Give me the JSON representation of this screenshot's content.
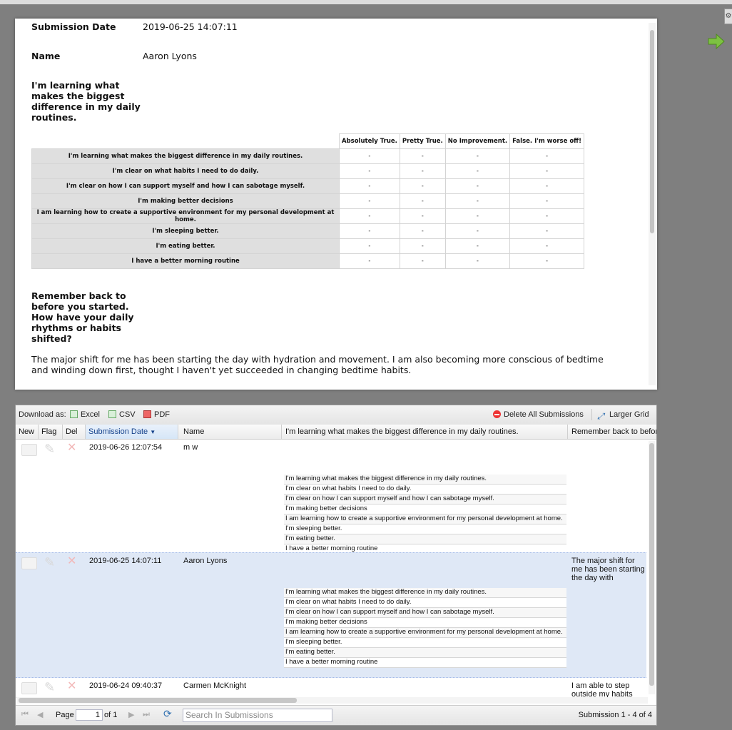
{
  "detail": {
    "submission_date_label": "Submission Date",
    "submission_date_value": "2019-06-25 14:07:11",
    "name_label": "Name",
    "name_value": "Aaron Lyons",
    "matrix_question": "I'm learning what makes the biggest difference in my daily routines.",
    "matrix_columns": [
      "Absolutely True.",
      "Pretty True.",
      "No Improvement.",
      "False. I'm worse off!"
    ],
    "matrix_rows": [
      {
        "label": "I'm learning what makes the biggest difference in my daily routines.",
        "values": [
          "-",
          "-",
          "-",
          "-"
        ]
      },
      {
        "label": "I'm clear on what habits I need to do daily.",
        "values": [
          "-",
          "-",
          "-",
          "-"
        ]
      },
      {
        "label": "I'm clear on how I can support myself and how I can sabotage myself.",
        "values": [
          "-",
          "-",
          "-",
          "-"
        ]
      },
      {
        "label": "I'm making better decisions",
        "values": [
          "-",
          "-",
          "-",
          "-"
        ]
      },
      {
        "label": "I am learning how to create a supportive environment for my personal development at home.",
        "values": [
          "-",
          "-",
          "-",
          "-"
        ]
      },
      {
        "label": "I'm sleeping better.",
        "values": [
          "-",
          "-",
          "-",
          "-"
        ]
      },
      {
        "label": "I'm eating better.",
        "values": [
          "-",
          "-",
          "-",
          "-"
        ]
      },
      {
        "label": "I have a better morning routine",
        "values": [
          "-",
          "-",
          "-",
          "-"
        ]
      }
    ],
    "rhythm_question": "Remember back to before you started. How have your daily rhythms or habits shifted?",
    "rhythm_answer": "The major shift for me has been starting the day with hydration and movement. I am also becoming more conscious of bedtime and winding down first, thought I haven't yet succeeded in changing bedtime habits."
  },
  "toolbar": {
    "download_label": "Download as:",
    "excel": "Excel",
    "csv": "CSV",
    "pdf": "PDF",
    "delete_all": "Delete All Submissions",
    "larger_grid": "Larger Grid"
  },
  "columns": {
    "new": "New",
    "flag": "Flag",
    "del": "Del",
    "submission_date": "Submission Date",
    "name": "Name",
    "q1": "I'm learning what makes the biggest difference in my daily routines.",
    "q2": "Remember back to before you started."
  },
  "rows": [
    {
      "date": "2019-06-26 12:07:54",
      "name": "m w",
      "matrix": [
        "I'm learning what makes the biggest difference in my daily routines.",
        "I'm clear on what habits I need to do daily.",
        "I'm clear on how I can support myself and how I can sabotage myself.",
        "I'm making better decisions",
        "I am learning how to create a supportive environment for my personal development at home.",
        "I'm sleeping better.",
        "I'm eating better.",
        "I have a better morning routine"
      ],
      "answer": ""
    },
    {
      "date": "2019-06-25 14:07:11",
      "name": "Aaron Lyons",
      "matrix": [
        "I'm learning what makes the biggest difference in my daily routines.",
        "I'm clear on what habits I need to do daily.",
        "I'm clear on how I can support myself and how I can sabotage myself.",
        "I'm making better decisions",
        "I am learning how to create a supportive environment for my personal development at home.",
        "I'm sleeping better.",
        "I'm eating better.",
        "I have a better morning routine"
      ],
      "answer": "The major shift for me has been starting the day with hydration and movement. I am also becoming more conscious of bedtime and winding down first, thought I haven't yet succeeded in changing bedtime habits."
    },
    {
      "date": "2019-06-24 09:40:37",
      "name": "Carmen McKnight",
      "answer": "I am able to step outside my habits and practice my habits. I"
    }
  ],
  "pager": {
    "page_label": "Page",
    "page_value": "1",
    "of_label": "of 1",
    "search_placeholder": "Search In Submissions",
    "summary": "Submission 1 - 4 of 4"
  },
  "colors": {
    "selected_row": "#dfe8f6",
    "link_blue": "#15428b",
    "next_arrow": "#7dc142"
  }
}
